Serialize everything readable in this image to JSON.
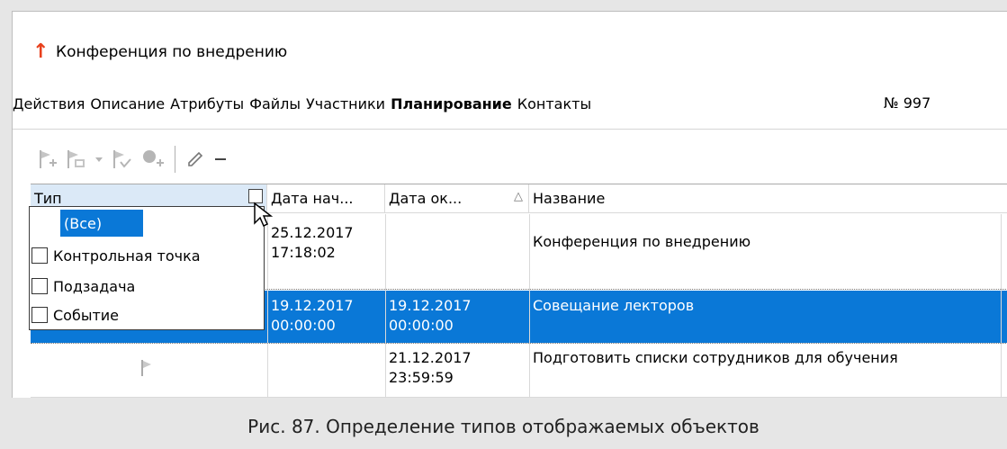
{
  "window": {
    "title": "Конференция по внедрению",
    "title_icon": "red-up-arrow-icon",
    "accent_color": "#e8401c"
  },
  "tabs": [
    {
      "label": "Действия"
    },
    {
      "label": "Описание"
    },
    {
      "label": "Атрибуты"
    },
    {
      "label": "Файлы"
    },
    {
      "label": "Участники"
    },
    {
      "label": "Планирование",
      "active": true
    },
    {
      "label": "Контакты"
    }
  ],
  "record_number": "№ 997",
  "toolbar": {
    "icons": [
      "add-flag-icon",
      "add-task-icon",
      "dropdown-arrow-icon",
      "checked-flag-icon",
      "add-event-icon",
      "edit-pencil-icon",
      "remove-minus-icon"
    ]
  },
  "grid": {
    "columns": [
      {
        "label": "Тип"
      },
      {
        "label": "Дата нач..."
      },
      {
        "label": "Дата ок..."
      },
      {
        "label": "Название"
      }
    ],
    "sort_indicator": "△",
    "rows": [
      {
        "start": [
          "25.12.2017",
          "17:18:02"
        ],
        "end": [
          "",
          ""
        ],
        "name": "Конференция по внедрению",
        "selected": false
      },
      {
        "start": [
          "19.12.2017",
          "00:00:00"
        ],
        "end": [
          "19.12.2017",
          "00:00:00"
        ],
        "name": "Совещание лекторов",
        "selected": true
      },
      {
        "start": [
          "",
          ""
        ],
        "end": [
          "21.12.2017",
          "23:59:59"
        ],
        "name": "Подготовить списки сотрудников для обучения",
        "selected": false
      }
    ]
  },
  "filter_dropdown": {
    "all_label": "(Все)",
    "options": [
      "Контрольная точка",
      "Подзадача",
      "Событие"
    ]
  },
  "selection_color": "#0a78d7",
  "caption": "Рис. 87. Определение типов отображаемых объектов"
}
